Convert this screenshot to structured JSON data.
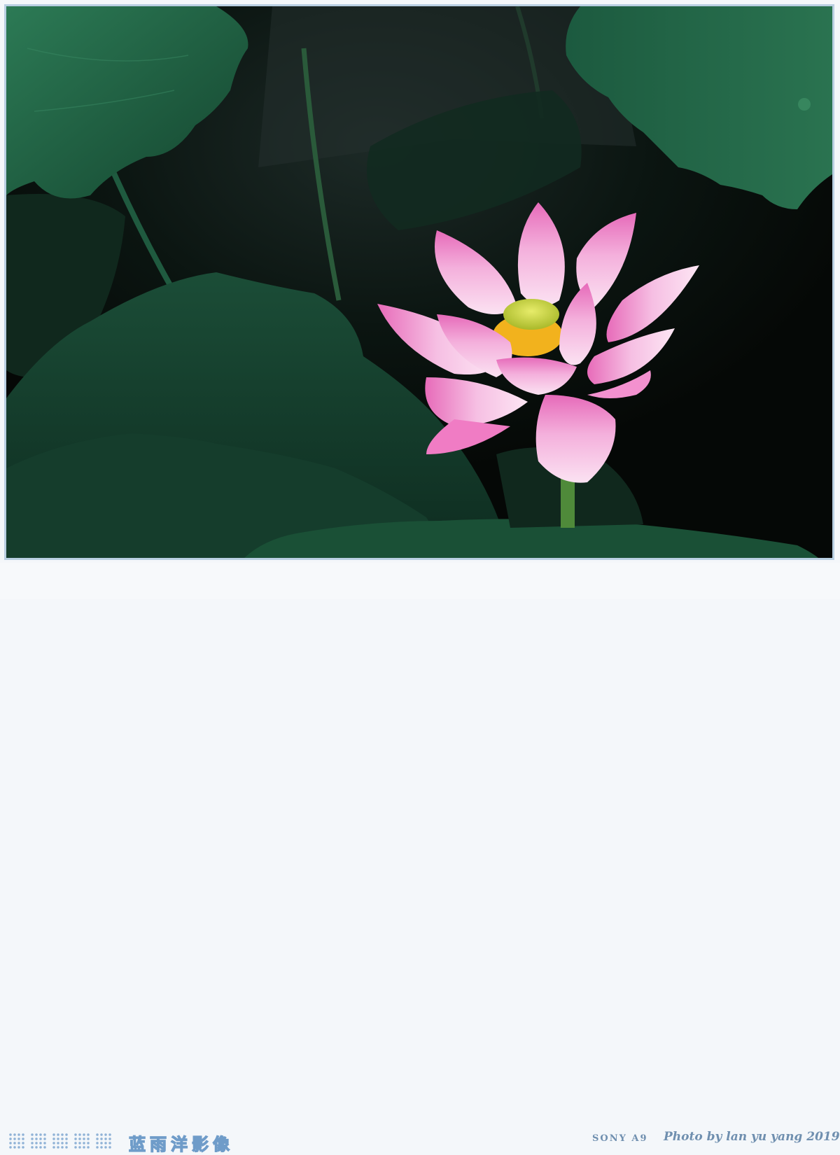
{
  "photo": {
    "subject": "pink lotus flower among lotus leaves",
    "colors": {
      "petal": "#f1a7d8",
      "petal_tip": "#e063b5",
      "pod": "#d8e04a",
      "stamen": "#f2b21d",
      "leaf": "#1f5a3f",
      "background": "#050806"
    }
  },
  "footer": {
    "brand": "蓝雨洋影像",
    "camera": "SONY A9",
    "credit": "Photo by lan yu yang 2019",
    "accent_color": "#7aa3cc"
  }
}
